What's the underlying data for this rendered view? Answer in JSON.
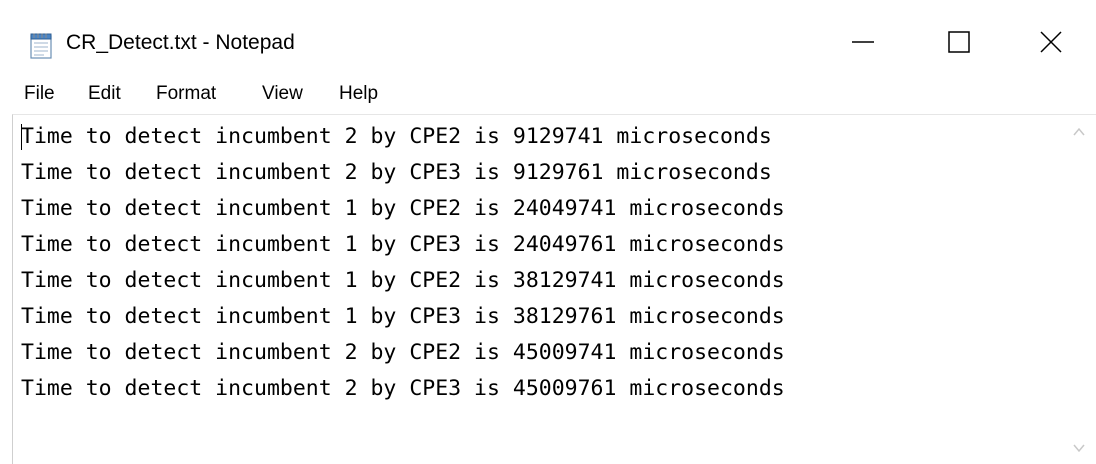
{
  "window": {
    "title": "CR_Detect.txt - Notepad",
    "app_icon": "notepad-icon",
    "controls": {
      "minimize_icon": "minimize-icon",
      "maximize_icon": "maximize-icon",
      "close_icon": "close-icon"
    }
  },
  "menu": {
    "file": "File",
    "edit": "Edit",
    "format": "Format",
    "view": "View",
    "help": "Help"
  },
  "document": {
    "lines": [
      "Time to detect incumbent 2 by CPE2 is 9129741 microseconds",
      "Time to detect incumbent 2 by CPE3 is 9129761 microseconds",
      "Time to detect incumbent 1 by CPE2 is 24049741 microseconds",
      "Time to detect incumbent 1 by CPE3 is 24049761 microseconds",
      "Time to detect incumbent 1 by CPE2 is 38129741 microseconds",
      "Time to detect incumbent 1 by CPE3 is 38129761 microseconds",
      "Time to detect incumbent 2 by CPE2 is 45009741 microseconds",
      "Time to detect incumbent 2 by CPE3 is 45009761 microseconds"
    ]
  },
  "colors": {
    "background": "#ffffff",
    "text": "#000000",
    "scroll_arrow": "#c8c8c8"
  }
}
